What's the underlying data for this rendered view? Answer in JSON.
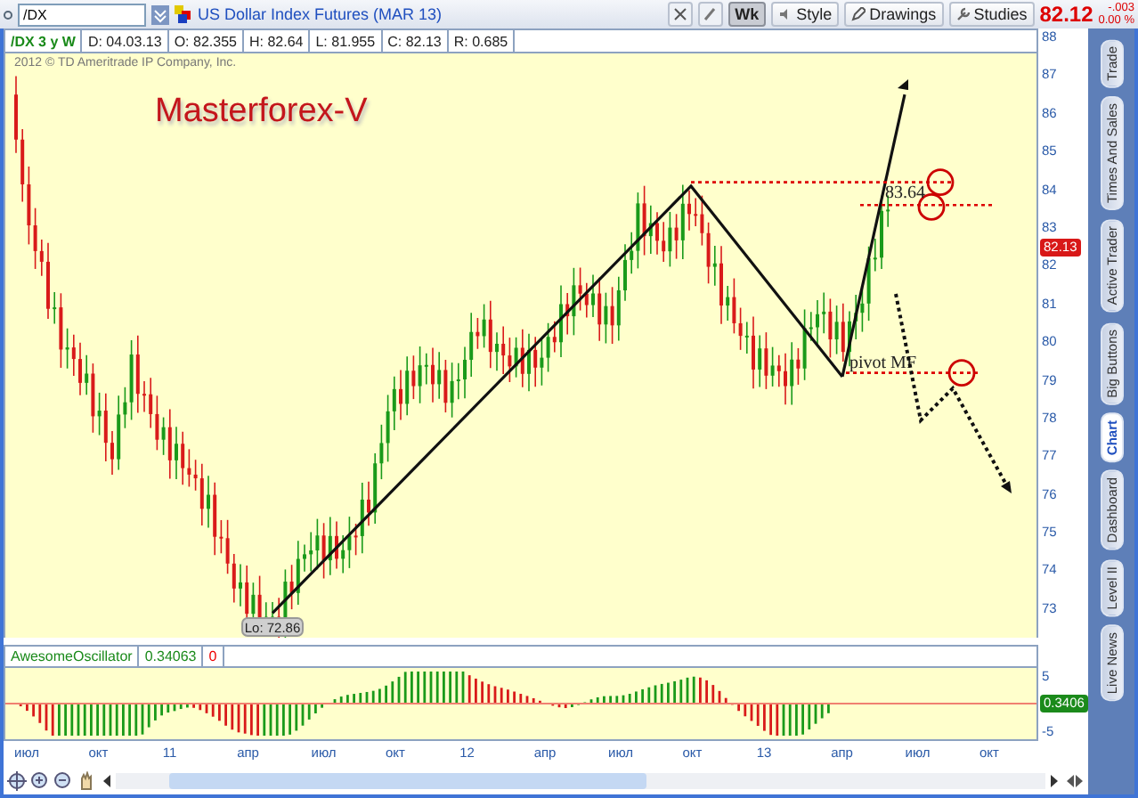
{
  "toolbar": {
    "symbol": "/DX",
    "title": "US Dollar Index Futures (MAR 13)",
    "buttons": [
      {
        "label": "Wk",
        "selected": true
      },
      {
        "label": "Style",
        "selected": false
      },
      {
        "label": "Drawings",
        "selected": false
      },
      {
        "label": "Studies",
        "selected": false
      }
    ],
    "last_price": "82.12",
    "change": "-.003",
    "change_pct": "0.00 %"
  },
  "info_row": [
    "/DX 3 y W",
    "D: 04.03.13",
    "O: 82.355",
    "H: 82.64",
    "L: 81.955",
    "C: 82.13",
    "R: 0.685"
  ],
  "copyright": "2012 © TD Ameritrade IP Company, Inc.",
  "chart_label": "Masterforex-V",
  "annotations": {
    "level": "83.64",
    "pivot": "pivot MF",
    "low": "Lo: 72.86"
  },
  "price_axis": {
    "ticks": [
      "88",
      "87",
      "86",
      "85",
      "84",
      "83",
      "82",
      "81",
      "80",
      "79",
      "78",
      "77",
      "76",
      "75",
      "74",
      "73"
    ],
    "badge": "82.13"
  },
  "oscillator": {
    "name": "AwesomeOscillator",
    "value": "0.34063",
    "setting": "0",
    "ticks": [
      "5",
      "-5"
    ],
    "badge": "0.3406"
  },
  "x_axis": [
    "июл",
    "окт",
    "11",
    "апр",
    "июл",
    "окт",
    "12",
    "апр",
    "июл",
    "окт",
    "13",
    "апр",
    "июл",
    "окт"
  ],
  "side_tabs": [
    {
      "label": "Trade",
      "selected": false
    },
    {
      "label": "Times And Sales",
      "selected": false
    },
    {
      "label": "Active Trader",
      "selected": false
    },
    {
      "label": "Big Buttons",
      "selected": false
    },
    {
      "label": "Chart",
      "selected": true
    },
    {
      "label": "Dashboard",
      "selected": false
    },
    {
      "label": "Level II",
      "selected": false
    },
    {
      "label": "Live News",
      "selected": false
    }
  ]
}
